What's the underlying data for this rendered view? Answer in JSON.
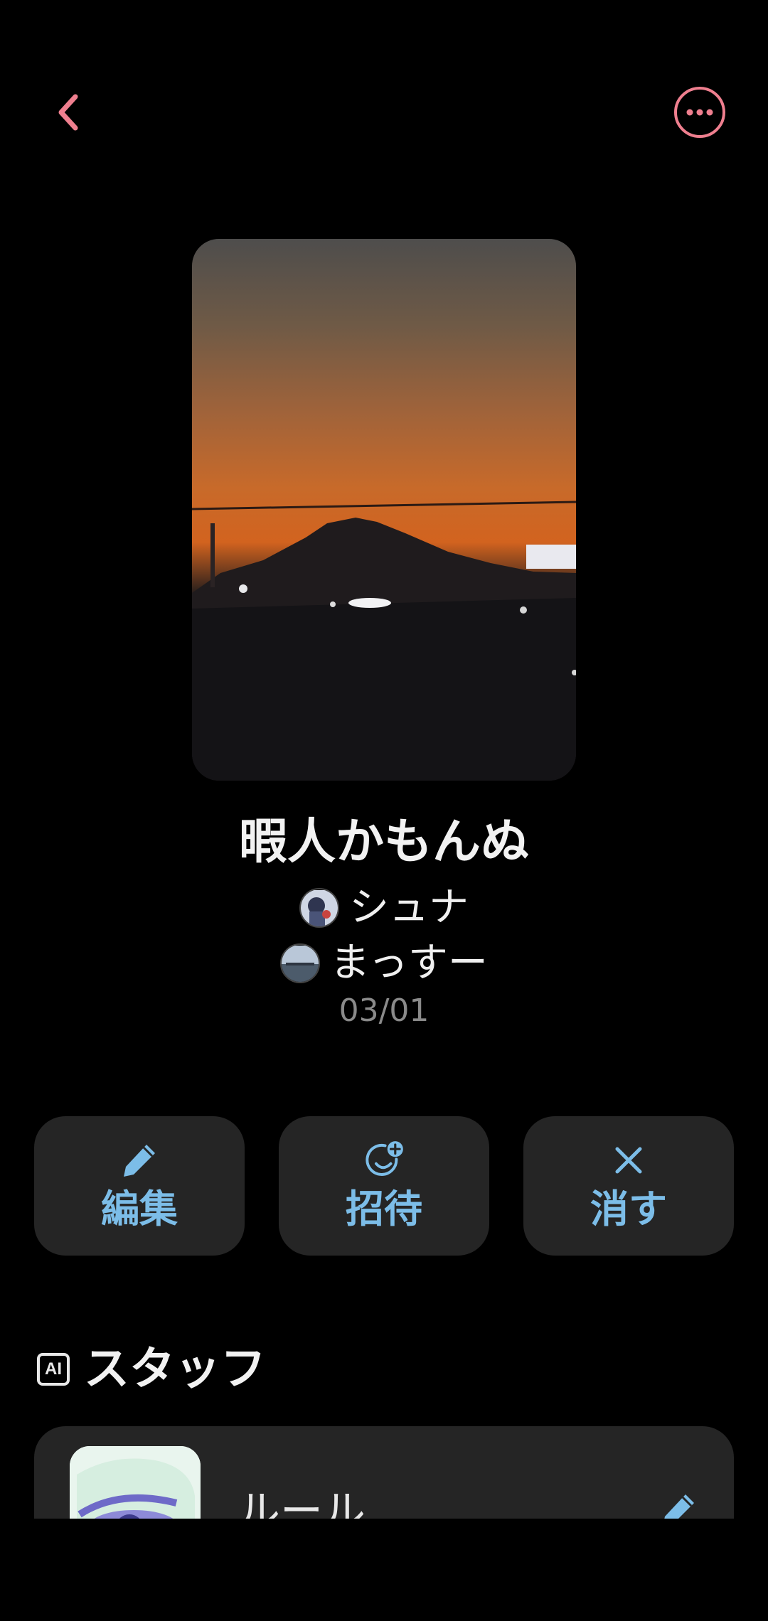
{
  "header": {
    "back_icon": "chevron-left-icon",
    "more_icon": "more-horizontal-icon",
    "accent_color": "#ef7f8f"
  },
  "group": {
    "title": "暇人かもんぬ",
    "members": [
      {
        "name": "シュナ"
      },
      {
        "name": "まっすー"
      }
    ],
    "date": "03/01"
  },
  "actions": {
    "edit_label": "編集",
    "invite_label": "招待",
    "delete_label": "消す",
    "label_color": "#7cbde8"
  },
  "staff_section": {
    "badge": "AI",
    "title": "スタッフ",
    "items": [
      {
        "name": "ルール"
      }
    ]
  }
}
